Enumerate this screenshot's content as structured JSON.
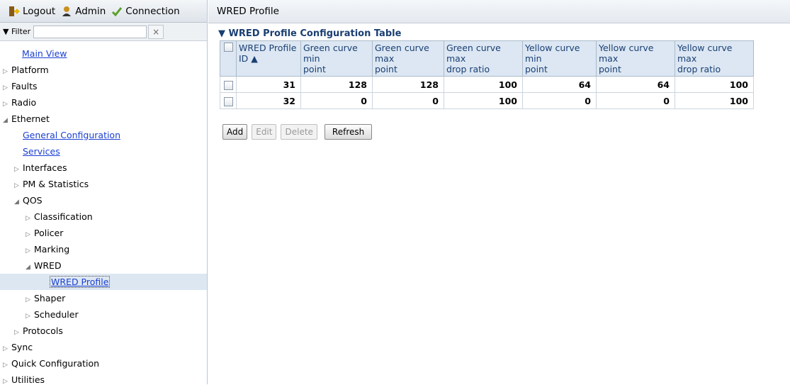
{
  "topbar": {
    "logout": "Logout",
    "admin": "Admin",
    "connection": "Connection"
  },
  "filter": {
    "label": "▼ Filter",
    "value": "",
    "clear": "×"
  },
  "tree": [
    {
      "label": "Main View",
      "indent": 0,
      "link": true
    },
    {
      "label": "Platform",
      "indent": 0,
      "arrow": "▷"
    },
    {
      "label": "Faults",
      "indent": 0,
      "arrow": "▷"
    },
    {
      "label": "Radio",
      "indent": 0,
      "arrow": "▷"
    },
    {
      "label": "Ethernet",
      "indent": 0,
      "arrow": "◢"
    },
    {
      "label": "General Configuration",
      "indent": 1,
      "link": true
    },
    {
      "label": "Services",
      "indent": 1,
      "link": true
    },
    {
      "label": "Interfaces",
      "indent": 1,
      "arrow": "▷"
    },
    {
      "label": "PM & Statistics",
      "indent": 1,
      "arrow": "▷"
    },
    {
      "label": "QOS",
      "indent": 1,
      "arrow": "◢"
    },
    {
      "label": "Classification",
      "indent": 2,
      "arrow": "▷"
    },
    {
      "label": "Policer",
      "indent": 2,
      "arrow": "▷"
    },
    {
      "label": "Marking",
      "indent": 2,
      "arrow": "▷"
    },
    {
      "label": "WRED",
      "indent": 2,
      "arrow": "◢"
    },
    {
      "label": "WRED Profile",
      "indent": 3,
      "link": true,
      "selected": true
    },
    {
      "label": "Shaper",
      "indent": 2,
      "arrow": "▷"
    },
    {
      "label": "Scheduler",
      "indent": 2,
      "arrow": "▷"
    },
    {
      "label": "Protocols",
      "indent": 1,
      "arrow": "▷"
    },
    {
      "label": "Sync",
      "indent": 0,
      "arrow": "▷"
    },
    {
      "label": "Quick Configuration",
      "indent": 0,
      "arrow": "▷"
    },
    {
      "label": "Utilities",
      "indent": 0,
      "arrow": "▷"
    }
  ],
  "page": {
    "title": "WRED Profile",
    "section": "▼ WRED Profile Configuration Table"
  },
  "table": {
    "headers": [
      [
        "WRED Profile",
        "ID ▲"
      ],
      [
        "Green curve min",
        "point"
      ],
      [
        "Green curve max",
        "point"
      ],
      [
        "Green curve max",
        "drop ratio"
      ],
      [
        "Yellow curve min",
        "point"
      ],
      [
        "Yellow curve max",
        "point"
      ],
      [
        "Yellow curve max",
        "drop ratio"
      ]
    ],
    "rows": [
      [
        "31",
        "128",
        "128",
        "100",
        "64",
        "64",
        "100"
      ],
      [
        "32",
        "0",
        "0",
        "100",
        "0",
        "0",
        "100"
      ]
    ]
  },
  "buttons": {
    "add": "Add",
    "edit": "Edit",
    "delete": "Delete",
    "refresh": "Refresh"
  }
}
